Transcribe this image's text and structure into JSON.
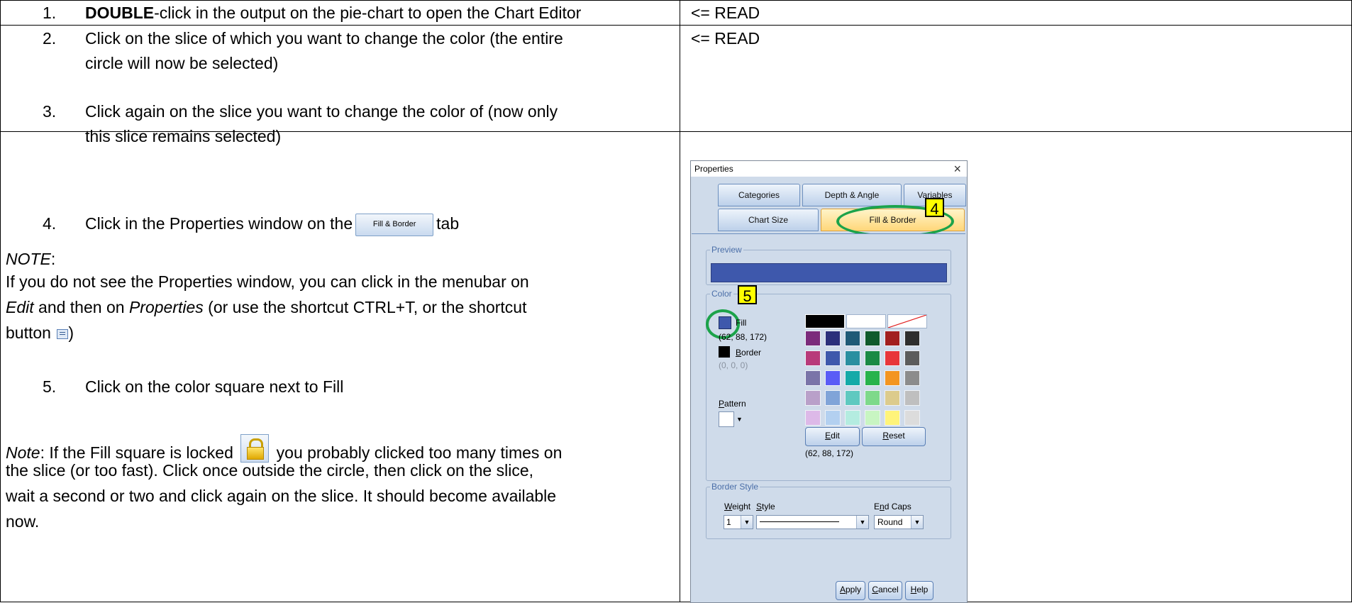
{
  "steps": {
    "s1": {
      "num": "1.",
      "bold": "DOUBLE",
      "text": "-click in the output on the pie-chart to open the Chart Editor",
      "read": "<= READ"
    },
    "s2": {
      "num": "2.",
      "line1": "Click on the slice of which you want to change the color (the entire",
      "line2": "circle will now be selected)",
      "read": "<= READ"
    },
    "s3": {
      "num": "3.",
      "line1": "Click again on the slice you want to change the color of (now only",
      "line2": "this slice remains selected)"
    },
    "s4": {
      "num": "4.",
      "before": "Click in the Properties window on the",
      "tab_image_label": "Fill & Border",
      "after": "tab"
    },
    "note1": {
      "label": "NOTE",
      "colon": ":",
      "line1": "If you do not see the Properties window, you can click in the menubar on",
      "edit": "Edit",
      "mid": " and then on ",
      "props": "Properties",
      "rest": " (or use the shortcut CTRL+T, or the shortcut",
      "line3a": "button ",
      "line3b": ")"
    },
    "s5": {
      "num": "5.",
      "text": "Click on the color square next to Fill"
    },
    "note2": {
      "label": "Note",
      "a": ": If the Fill square is locked ",
      "b": " you probably clicked too many times on",
      "line2": "the slice (or too fast). Click once outside the circle, then click on the slice,",
      "line3": "wait a second or two and click again on the slice. It should become available",
      "line4": "now."
    }
  },
  "properties_window": {
    "title": "Properties",
    "tabs_row1": [
      "Categories",
      "Depth & Angle",
      "Variables"
    ],
    "tabs_row2": [
      "Chart Size",
      "Fill & Border"
    ],
    "active_tab": "Fill & Border",
    "preview_legend": "Preview",
    "preview_color": "#3e58ac",
    "color_legend": "Color",
    "fill_label": "Fill",
    "fill_rgb": "(62, 88, 172)",
    "border_label": "Border",
    "border_rgb": "(0, 0, 0)",
    "pattern_label": "Pattern",
    "edit_button": "Edit",
    "reset_button": "Reset",
    "selected_rgb": "(62, 88, 172)",
    "border_style_legend": "Border Style",
    "weight_label": "Weight",
    "style_label": "Style",
    "end_caps_label": "End Caps",
    "weight_value": "1",
    "end_caps_value": "Round",
    "apply_button": "Apply",
    "cancel_button": "Cancel",
    "help_button": "Help",
    "callout_4": "4",
    "callout_5": "5",
    "palette_top": [
      "#000000",
      "#ffffff",
      "none"
    ],
    "palette": [
      [
        "#7b2b7b",
        "#2b2f7b",
        "#1f5a77",
        "#0f5a2c",
        "#a21f1f",
        "#2e2e2e"
      ],
      [
        "#b83a7a",
        "#3e58ac",
        "#2a8fa0",
        "#1b8a45",
        "#e8363a",
        "#5c5c5c"
      ],
      [
        "#7a74a8",
        "#5a5cf6",
        "#14aaa8",
        "#28b34c",
        "#f39520",
        "#8c8c8c"
      ],
      [
        "#b9a0c9",
        "#80a4d8",
        "#5fc9c0",
        "#7ed98a",
        "#dccb8c",
        "#bfbfbf"
      ],
      [
        "#ddb9e8",
        "#b3d0f0",
        "#b4ece0",
        "#c8f5c2",
        "#fff47a",
        "#dcdcdc"
      ],
      [
        "#e6ecf2",
        "#e6ecf2",
        "#e6ecf2",
        "#e6ecf2",
        "#e6ecf2",
        "#e6ecf2"
      ]
    ]
  }
}
